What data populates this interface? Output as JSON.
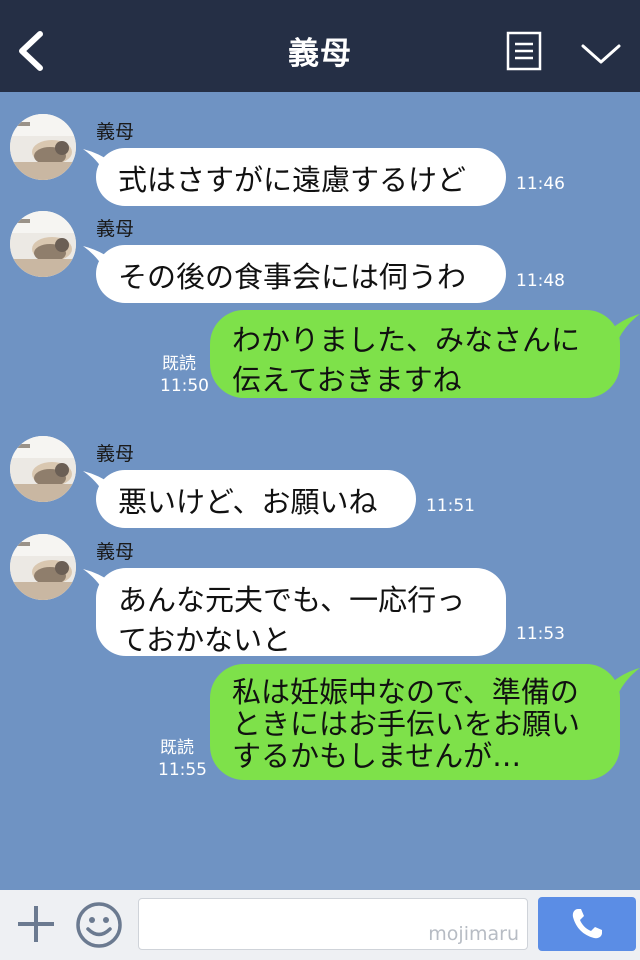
{
  "header": {
    "title": "義母"
  },
  "messages": [
    {
      "side": "in",
      "sender": "義母",
      "text": "式はさすがに遠慮するけど",
      "time": "11:46"
    },
    {
      "side": "in",
      "sender": "義母",
      "text": "その後の食事会には伺うわ",
      "time": "11:48"
    },
    {
      "side": "out",
      "text": "わかりました、みなさんに\n伝えておきますね",
      "read": "既読",
      "time": "11:50"
    },
    {
      "side": "in",
      "sender": "義母",
      "text": "悪いけど、お願いね",
      "time": "11:51"
    },
    {
      "side": "in",
      "sender": "義母",
      "text": "あんな元夫でも、一応行っ\nておかないと",
      "time": "11:53"
    },
    {
      "side": "out",
      "text": "私は妊娠中なので、準備の\nときにはお手伝いをお願い\nするかもしませんが…",
      "read": "既読",
      "time": "11:55"
    }
  ],
  "footer": {
    "watermark": "mojimaru"
  },
  "colors": {
    "background": "#6f93c3",
    "header": "#252f45",
    "incoming": "#ffffff",
    "outgoing": "#7ee14a",
    "call_button": "#5b8de5"
  },
  "icons": [
    "back-chevron-icon",
    "menu-list-icon",
    "chevron-down-icon",
    "plus-icon",
    "smiley-icon",
    "phone-icon"
  ]
}
